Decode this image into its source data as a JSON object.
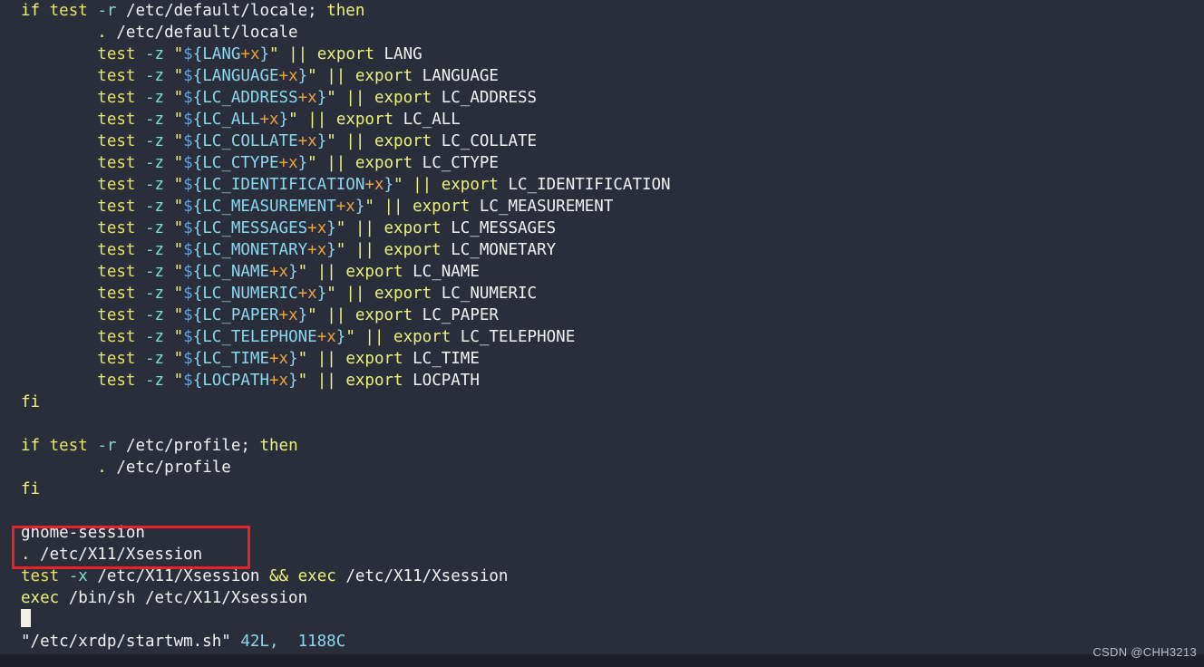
{
  "terminal": {
    "background_color": "#2a2e3b",
    "foreground_color": "#f2f2f2",
    "lines": [
      {
        "id": "l1",
        "text": "if test -r /etc/default/locale; then"
      },
      {
        "id": "l2",
        "text": "        . /etc/default/locale"
      },
      {
        "id": "l3",
        "text": "        test -z \"${LANG+x}\" || export LANG"
      },
      {
        "id": "l4",
        "text": "        test -z \"${LANGUAGE+x}\" || export LANGUAGE"
      },
      {
        "id": "l5",
        "text": "        test -z \"${LC_ADDRESS+x}\" || export LC_ADDRESS"
      },
      {
        "id": "l6",
        "text": "        test -z \"${LC_ALL+x}\" || export LC_ALL"
      },
      {
        "id": "l7",
        "text": "        test -z \"${LC_COLLATE+x}\" || export LC_COLLATE"
      },
      {
        "id": "l8",
        "text": "        test -z \"${LC_CTYPE+x}\" || export LC_CTYPE"
      },
      {
        "id": "l9",
        "text": "        test -z \"${LC_IDENTIFICATION+x}\" || export LC_IDENTIFICATION"
      },
      {
        "id": "l10",
        "text": "        test -z \"${LC_MEASUREMENT+x}\" || export LC_MEASUREMENT"
      },
      {
        "id": "l11",
        "text": "        test -z \"${LC_MESSAGES+x}\" || export LC_MESSAGES"
      },
      {
        "id": "l12",
        "text": "        test -z \"${LC_MONETARY+x}\" || export LC_MONETARY"
      },
      {
        "id": "l13",
        "text": "        test -z \"${LC_NAME+x}\" || export LC_NAME"
      },
      {
        "id": "l14",
        "text": "        test -z \"${LC_NUMERIC+x}\" || export LC_NUMERIC"
      },
      {
        "id": "l15",
        "text": "        test -z \"${LC_PAPER+x}\" || export LC_PAPER"
      },
      {
        "id": "l16",
        "text": "        test -z \"${LC_TELEPHONE+x}\" || export LC_TELEPHONE"
      },
      {
        "id": "l17",
        "text": "        test -z \"${LC_TIME+x}\" || export LC_TIME"
      },
      {
        "id": "l18",
        "text": "        test -z \"${LOCPATH+x}\" || export LOCPATH"
      },
      {
        "id": "l19",
        "text": "fi"
      },
      {
        "id": "l20",
        "text": ""
      },
      {
        "id": "l21",
        "text": "if test -r /etc/profile; then"
      },
      {
        "id": "l22",
        "text": "        . /etc/profile"
      },
      {
        "id": "l23",
        "text": "fi"
      },
      {
        "id": "l24",
        "text": ""
      },
      {
        "id": "l25",
        "text": "gnome-session"
      },
      {
        "id": "l26",
        "text": ". /etc/X11/Xsession"
      },
      {
        "id": "l27",
        "text": "test -x /etc/X11/Xsession && exec /etc/X11/Xsession"
      },
      {
        "id": "l28",
        "text": "exec /bin/sh /etc/X11/Xsession"
      }
    ],
    "keyword_if": "if",
    "keyword_then": "then",
    "keyword_fi": "fi",
    "keyword_export": "export",
    "keyword_exec": "exec",
    "command_test": "test",
    "flag_r": "-r",
    "flag_z": "-z",
    "flag_x": "-x",
    "operator_or": "||",
    "operator_and": "&&",
    "dollar": "$",
    "plus_x": "+x",
    "quote": "\"",
    "dot": ".",
    "paths": {
      "etc_default_locale": "/etc/default/locale",
      "etc_default_locale_semi": "/etc/default/locale;",
      "etc_profile_semi": "/etc/profile;",
      "etc_profile": "/etc/profile",
      "etc_x11_xsession": "/etc/X11/Xsession",
      "bin_sh": "/bin/sh"
    },
    "vars": {
      "LANG": "LANG",
      "LANGUAGE": "LANGUAGE",
      "LC_ADDRESS": "LC_ADDRESS",
      "LC_ALL": "LC_ALL",
      "LC_COLLATE": "LC_COLLATE",
      "LC_CTYPE": "LC_CTYPE",
      "LC_IDENTIFICATION": "LC_IDENTIFICATION",
      "LC_MEASUREMENT": "LC_MEASUREMENT",
      "LC_MESSAGES": "LC_MESSAGES",
      "LC_MONETARY": "LC_MONETARY",
      "LC_NAME": "LC_NAME",
      "LC_NUMERIC": "LC_NUMERIC",
      "LC_PAPER": "LC_PAPER",
      "LC_TELEPHONE": "LC_TELEPHONE",
      "LC_TIME": "LC_TIME",
      "LOCPATH": "LOCPATH"
    },
    "braces": {
      "LANG": "{LANG",
      "LANGUAGE": "{LANGUAGE",
      "LC_ADDRESS": "{LC_ADDRESS",
      "LC_ALL": "{LC_ALL",
      "LC_COLLATE": "{LC_COLLATE",
      "LC_CTYPE": "{LC_CTYPE",
      "LC_IDENTIFICATION": "{LC_IDENTIFICATION",
      "LC_MEASUREMENT": "{LC_MEASUREMENT",
      "LC_MESSAGES": "{LC_MESSAGES",
      "LC_MONETARY": "{LC_MONETARY",
      "LC_NAME": "{LC_NAME",
      "LC_NUMERIC": "{LC_NUMERIC",
      "LC_PAPER": "{LC_PAPER",
      "LC_TELEPHONE": "{LC_TELEPHONE",
      "LC_TIME": "{LC_TIME",
      "LOCPATH": "{LOCPATH",
      "close": "}"
    },
    "gnome_session": "gnome-session",
    "status_line": {
      "file": "\"/etc/xrdp/startwm.sh\"",
      "lines_count": "42L,",
      "chars_count": "1188C"
    }
  },
  "annotation": {
    "box_color": "#ec2029",
    "highlighted_lines": [
      "gnome-session",
      ". /etc/X11/Xsession"
    ]
  },
  "watermark": {
    "text": "CSDN @CHH3213"
  }
}
